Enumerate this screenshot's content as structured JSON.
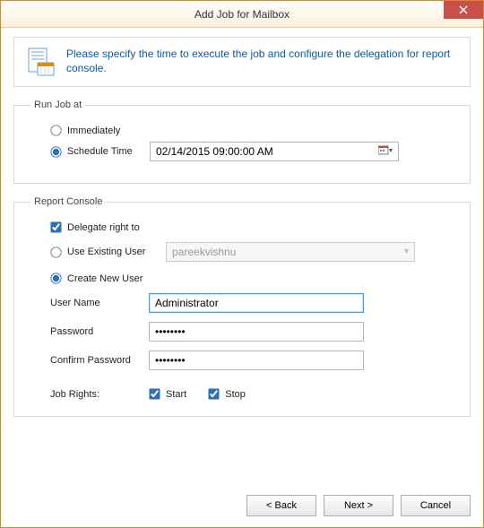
{
  "window": {
    "title": "Add Job for Mailbox"
  },
  "intro": {
    "text": "Please specify the time to execute the job and configure the delegation for report console."
  },
  "runJob": {
    "legend": "Run Job at",
    "immediately": "Immediately",
    "scheduleTime": "Schedule Time",
    "scheduleValue": "02/14/2015 09:00:00 AM"
  },
  "report": {
    "legend": "Report Console",
    "delegate": "Delegate right to",
    "useExisting": "Use Existing User",
    "existingUserValue": "pareekvishnu",
    "createNew": "Create New User",
    "userNameLabel": "User Name",
    "userNameValue": "Administrator",
    "passwordLabel": "Password",
    "passwordValue": "••••••••",
    "confirmLabel": "Confirm Password",
    "confirmValue": "••••••••",
    "jobRightsLabel": "Job Rights:",
    "startLabel": "Start",
    "stopLabel": "Stop"
  },
  "buttons": {
    "back": "< Back",
    "next": "Next >",
    "cancel": "Cancel"
  }
}
